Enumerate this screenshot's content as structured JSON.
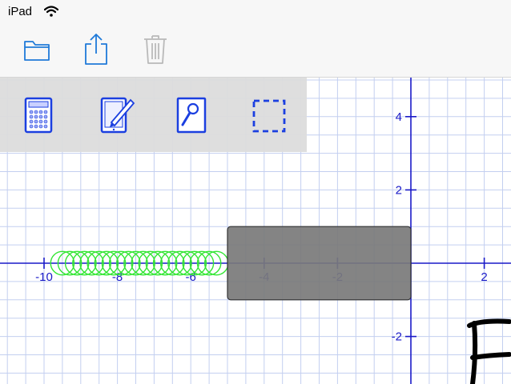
{
  "status_bar": {
    "device": "iPad",
    "wifi_icon": "wifi-icon"
  },
  "toolbar": {
    "items": [
      {
        "name": "folder-button",
        "icon": "folder-icon",
        "enabled": true
      },
      {
        "name": "share-button",
        "icon": "share-icon",
        "enabled": true
      },
      {
        "name": "trash-button",
        "icon": "trash-icon",
        "enabled": false
      }
    ]
  },
  "tool_palette": {
    "tools": [
      {
        "name": "calculator-tool",
        "icon": "calculator-icon"
      },
      {
        "name": "edit-tool",
        "icon": "tablet-pen-icon"
      },
      {
        "name": "magnify-tool",
        "icon": "magnifier-icon"
      },
      {
        "name": "select-tool",
        "icon": "dashed-selection-icon"
      }
    ]
  },
  "graph": {
    "x_ticks": [
      "-10",
      "-8",
      "-6",
      "-4",
      "-2",
      "2"
    ],
    "y_ticks": [
      "4",
      "2",
      "-2"
    ],
    "colors": {
      "grid": "#c3cff0",
      "axis": "#1a1ac8",
      "circles": "#33e633",
      "selection_fill": "#7a7a7a",
      "ink": "#000000"
    },
    "circle_trail": {
      "from_x": -9.5,
      "to_x": -5.3,
      "y": 0,
      "radius": 0.32,
      "count": 22
    },
    "selection_rect": {
      "x1": -5.0,
      "x2": 0.0,
      "y1": -1.0,
      "y2": 1.0
    },
    "handwriting_glyph": "F"
  }
}
